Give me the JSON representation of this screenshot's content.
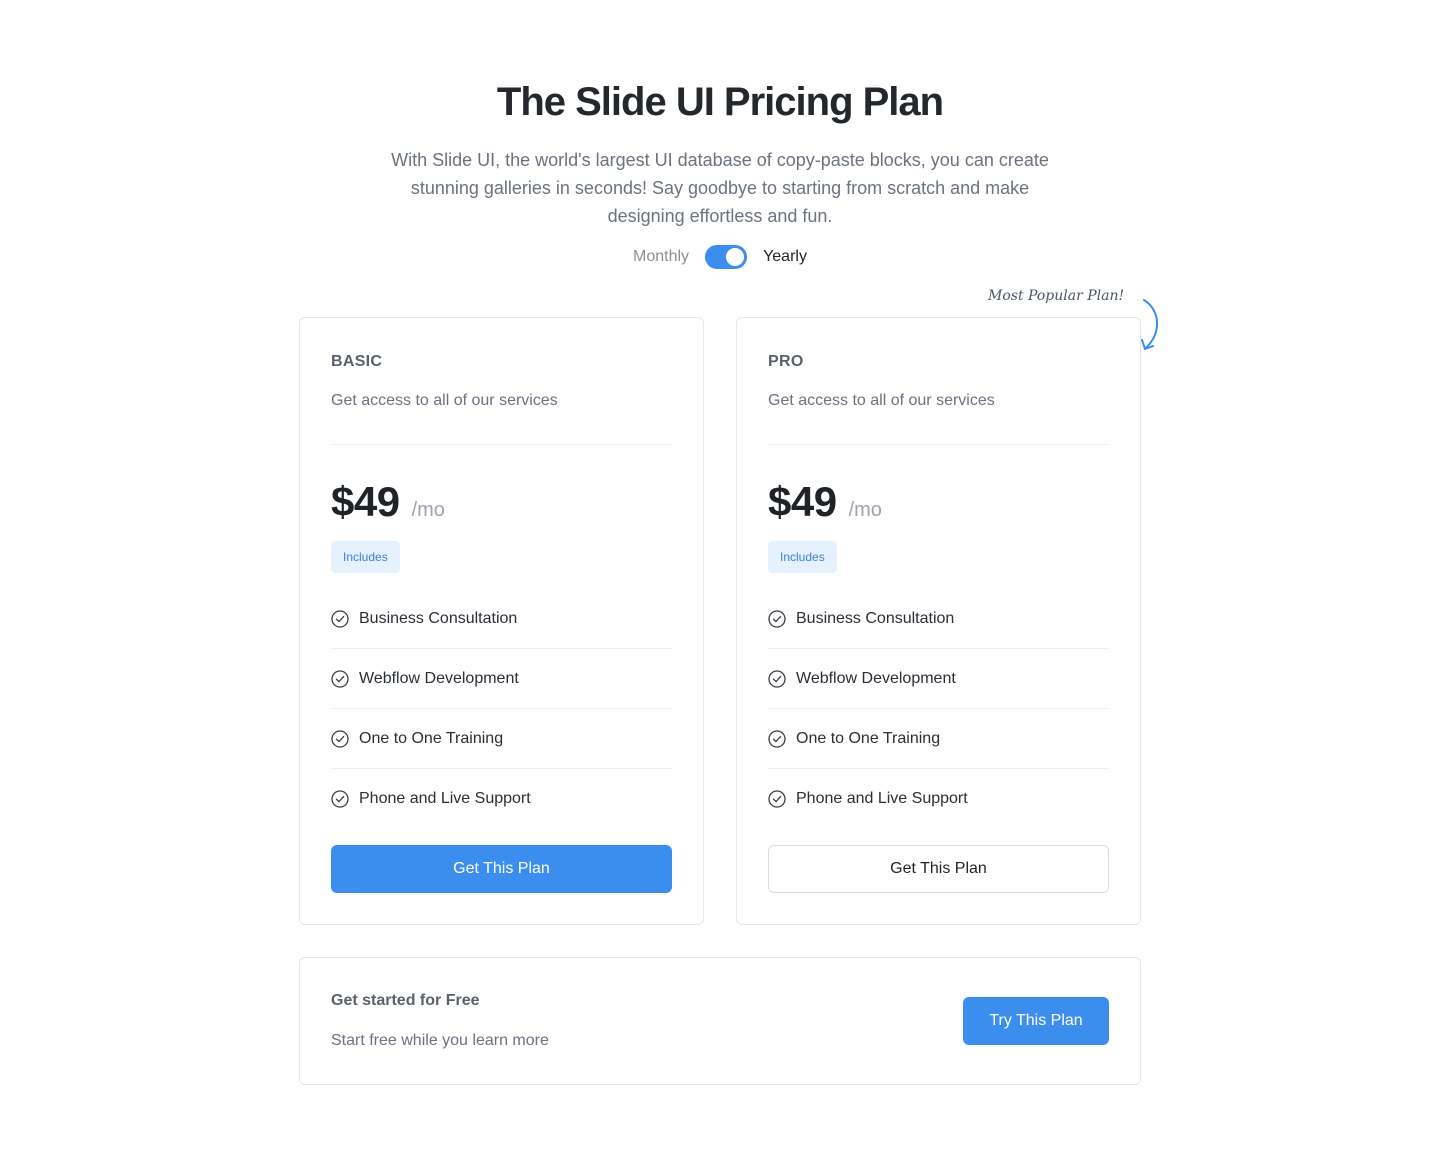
{
  "header": {
    "title": "The Slide UI Pricing Plan",
    "subtitle": "With Slide UI, the world's largest UI database of copy-paste blocks, you can create stunning galleries in seconds! Say goodbye to starting from scratch and make designing effortless and fun."
  },
  "billing_toggle": {
    "left_label": "Monthly",
    "right_label": "Yearly",
    "selected": "Yearly"
  },
  "popular_note": "Most Popular Plan!",
  "colors": {
    "accent": "#3b8eee",
    "badge_bg": "#e5f1fd",
    "badge_text": "#3b82d6"
  },
  "plans": [
    {
      "name": "BASIC",
      "description": "Get access to all of our services",
      "price": "$49",
      "period": "/mo",
      "badge": "Includes",
      "features": [
        "Business Consultation",
        "Webflow Development",
        "One to One Training",
        "Phone and Live Support"
      ],
      "cta": "Get This Plan"
    },
    {
      "name": "PRO",
      "description": "Get access to all of our services",
      "price": "$49",
      "period": "/mo",
      "badge": "Includes",
      "features": [
        "Business Consultation",
        "Webflow Development",
        "One to One Training",
        "Phone and Live Support"
      ],
      "cta": "Get This Plan"
    }
  ],
  "free_plan": {
    "title": "Get started for Free",
    "description": "Start free while you learn more",
    "cta": "Try This Plan"
  },
  "icons": {
    "feature": "check-circle-icon",
    "popular": "curved-arrow-icon"
  }
}
